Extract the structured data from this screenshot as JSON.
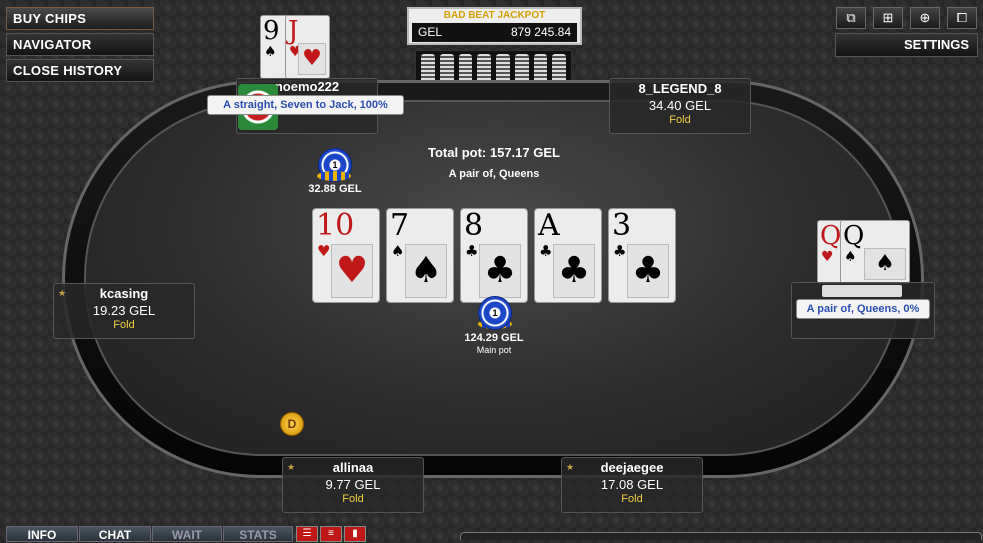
{
  "menu": {
    "buy_chips": "BUY CHIPS",
    "navigator": "NAVIGATOR",
    "close_history": "CLOSE HISTORY"
  },
  "toolbar": {
    "settings": "SETTINGS",
    "icons": [
      "windows-icon",
      "grid-icon",
      "add-table-icon",
      "lobby-icon"
    ]
  },
  "jackpot": {
    "title": "BAD BEAT JACKPOT",
    "currency": "GEL",
    "amount": "879 245.84"
  },
  "pot": {
    "total": "Total pot: 157.17 GEL",
    "hand": "A pair of, Queens",
    "main_amount": "124.29 GEL",
    "main_label": "Main pot",
    "chip_value": "1"
  },
  "board": [
    {
      "rank": "10",
      "suit": "♥",
      "color": "red"
    },
    {
      "rank": "7",
      "suit": "♠",
      "color": "black"
    },
    {
      "rank": "8",
      "suit": "♣",
      "color": "black"
    },
    {
      "rank": "A",
      "suit": "♣",
      "color": "black"
    },
    {
      "rank": "3",
      "suit": "♣",
      "color": "black"
    }
  ],
  "seats": {
    "noemo": {
      "name": "noemo222",
      "hand": "A straight, Seven to Jack, 100%",
      "bet": "32.88 GEL",
      "chip_value": "1",
      "cards": [
        {
          "rank": "9",
          "suit": "♠"
        },
        {
          "rank": "J",
          "suit": "♥"
        }
      ]
    },
    "legend": {
      "name": "8_LEGEND_8",
      "stack": "34.40 GEL",
      "status": "Fold"
    },
    "kcasing": {
      "name": "kcasing",
      "stack": "19.23 GEL",
      "status": "Fold"
    },
    "right": {
      "hand": "A pair of, Queens, 0%",
      "cards": [
        {
          "rank": "Q",
          "suit": "♥"
        },
        {
          "rank": "Q",
          "suit": "♠"
        }
      ]
    },
    "allinaa": {
      "name": "allinaa",
      "stack": "9.77 GEL",
      "status": "Fold"
    },
    "deejaegee": {
      "name": "deejaegee",
      "stack": "17.08 GEL",
      "status": "Fold"
    }
  },
  "dealer": "D",
  "tabs": {
    "info": "INFO",
    "chat": "CHAT",
    "wait": "WAIT",
    "stats": "STATS"
  },
  "colors": {
    "accent": "#c01818",
    "bubble_text": "#2a4fb0",
    "status": "#f0d040"
  }
}
